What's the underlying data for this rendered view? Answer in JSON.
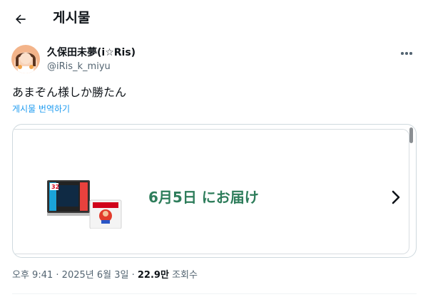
{
  "header": {
    "title": "게시물"
  },
  "author": {
    "display_name": "久保田未夢(i☆Ris)",
    "handle": "@iRis_k_miyu"
  },
  "tweet": {
    "text": "あまぞん様しか勝たん",
    "translate_label": "게시물 번역하기"
  },
  "card": {
    "delivery_text": "6月5日 にお届け",
    "product_box_label": "32"
  },
  "meta": {
    "time": "오후 9:41",
    "separator": "·",
    "date": "2025년 6월 3일",
    "views_count": "22.9만",
    "views_label": "조회수"
  },
  "colors": {
    "accent": "#1d9bf0",
    "text_primary": "#0f1419",
    "text_secondary": "#536471",
    "border": "#cfd9de",
    "delivery_green": "#2e7d5b"
  },
  "icons": {
    "back": "arrow-left-icon",
    "more": "more-dots-icon",
    "card_next": "chevron-right-icon"
  }
}
